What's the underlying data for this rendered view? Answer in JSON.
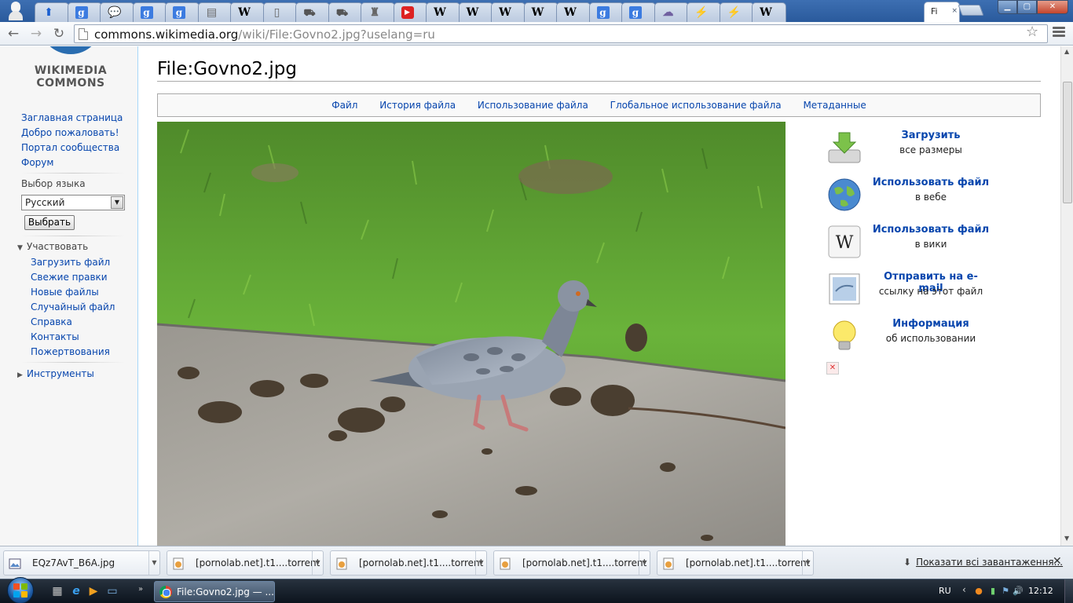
{
  "browser": {
    "tabs": [
      {
        "icon": "profile-icon"
      },
      {
        "icon": "upload-arrow-icon",
        "glyph": "⬆"
      },
      {
        "icon": "google-icon",
        "glyph": "g"
      },
      {
        "icon": "chat-icon",
        "glyph": "💬"
      },
      {
        "icon": "google-icon",
        "glyph": "g"
      },
      {
        "icon": "google-icon",
        "glyph": "g"
      },
      {
        "icon": "document-icon",
        "glyph": "▤"
      },
      {
        "icon": "wikipedia-icon",
        "glyph": "W"
      },
      {
        "icon": "page-icon",
        "glyph": "▯"
      },
      {
        "icon": "car-icon",
        "glyph": "⛟"
      },
      {
        "icon": "car-icon",
        "glyph": "⛟"
      },
      {
        "icon": "tower-icon",
        "glyph": "♜"
      },
      {
        "icon": "youtube-icon",
        "glyph": "▶"
      },
      {
        "icon": "wikipedia-icon",
        "glyph": "W"
      },
      {
        "icon": "wikipedia-icon",
        "glyph": "W"
      },
      {
        "icon": "wikipedia-icon",
        "glyph": "W"
      },
      {
        "icon": "wikipedia-icon",
        "glyph": "W"
      },
      {
        "icon": "wikipedia-icon",
        "glyph": "W"
      },
      {
        "icon": "google-icon",
        "glyph": "g"
      },
      {
        "icon": "google-icon",
        "glyph": "g"
      },
      {
        "icon": "cloud-icon",
        "glyph": "☁"
      },
      {
        "icon": "bolt-icon",
        "glyph": "⚡"
      },
      {
        "icon": "bolt-icon",
        "glyph": "⚡"
      },
      {
        "icon": "wikipedia-icon",
        "glyph": "W"
      }
    ],
    "active_tab_label": "Fi",
    "tab_close_glyph": "×",
    "window_buttons": {
      "minimize": "▁",
      "maximize": "▢",
      "close": "✕"
    },
    "nav": {
      "back": "←",
      "forward": "→",
      "reload": "↻"
    },
    "url_host": "commons.wikimedia.org",
    "url_path": "/wiki/File:Govno2.jpg?uselang=ru",
    "star_glyph": "☆"
  },
  "sidebar": {
    "logo_line1": "WIKIMEDIA",
    "logo_line2": "COMMONS",
    "nav_links": [
      "Заглавная страница",
      "Добро пожаловать!",
      "Портал сообщества",
      "Форум"
    ],
    "language_label": "Выбор языка",
    "language_selected": "Русский",
    "language_button": "Выбрать",
    "participate_heading": "Участвовать",
    "participate_links": [
      "Загрузить файл",
      "Свежие правки",
      "Новые файлы",
      "Случайный файл",
      "Справка",
      "Контакты",
      "Пожертвования"
    ],
    "tools_heading": "Инструменты"
  },
  "content": {
    "title": "File:Govno2.jpg",
    "toc": [
      "Файл",
      "История файла",
      "Использование файла",
      "Глобальное использование файла",
      "Метаданные"
    ],
    "file_tools": [
      {
        "icon": "download-icon",
        "title": "Загрузить",
        "subtitle": "все размеры"
      },
      {
        "icon": "globe-icon",
        "title": "Использовать файл",
        "subtitle": "в вебе"
      },
      {
        "icon": "wikipedia-icon",
        "title": "Использовать файл",
        "subtitle": "в вики"
      },
      {
        "icon": "email-icon",
        "title": "Отправить на e-mail",
        "subtitle": "ссылку на этот файл"
      },
      {
        "icon": "lightbulb-icon",
        "title": "Информация",
        "subtitle": "об использовании"
      }
    ],
    "tools_close_glyph": "✕"
  },
  "downloads": {
    "items": [
      {
        "icon": "image-file-icon",
        "name": "EQz7AvT_B6A.jpg"
      },
      {
        "icon": "torrent-file-icon",
        "name": "[pornolab.net].t1....torrent"
      },
      {
        "icon": "torrent-file-icon",
        "name": "[pornolab.net].t1....torrent"
      },
      {
        "icon": "torrent-file-icon",
        "name": "[pornolab.net].t1....torrent"
      },
      {
        "icon": "torrent-file-icon",
        "name": "[pornolab.net].t1....torrent"
      }
    ],
    "show_all": "Показати всі завантаження...",
    "close_glyph": "✕"
  },
  "taskbar": {
    "window_title": "File:Govno2.jpg — ...",
    "more_glyph": "»",
    "language": "RU",
    "tray_chevron": "‹",
    "clock": "12:12"
  },
  "colors": {
    "link": "#0645ad",
    "tab_strip": "#2a5a9c",
    "sidebar_bg": "#f6f6f6"
  }
}
